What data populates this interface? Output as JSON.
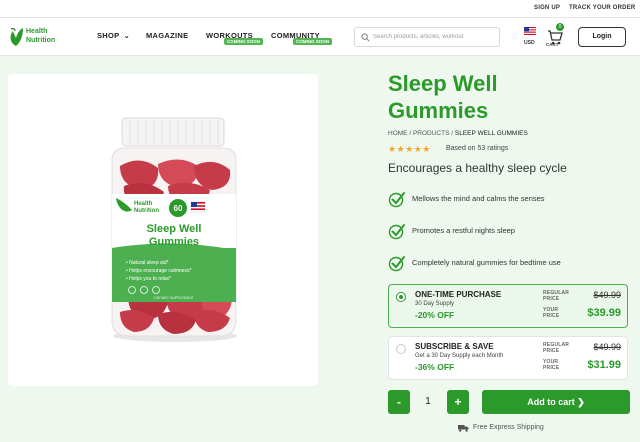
{
  "util": {
    "signup": "SIGN UP",
    "track_order": "TRACK YOUR ORDER"
  },
  "brand": {
    "line1": "Health",
    "line2": "Nutrition",
    "color": "#2b9a2b"
  },
  "nav": {
    "shop": "SHOP",
    "magazine": "MAGAZINE",
    "workouts": "WORKOUTS",
    "community": "COMMUNITY",
    "coming_soon": "COMING SOON"
  },
  "search": {
    "placeholder": "Search products, articles, workout"
  },
  "currency": "USD",
  "cart": {
    "label": "CART",
    "count": "0"
  },
  "login": "Login",
  "product": {
    "title": "Sleep Well Gummies",
    "title_line1": "Sleep Well",
    "title_line2": "Gummies",
    "breadcrumb": [
      "HOME",
      "PRODUCTS",
      "SLEEP WELL GUMMIES"
    ],
    "stars": "★★★★★",
    "rating_text": "Based on 53 ratings",
    "subtitle": "Encourages a healthy sleep cycle",
    "features": [
      "Mellows the mind and calms the senses",
      "Promotes a restful nights sleep",
      "Completely natural gummies for bedtime use"
    ]
  },
  "bottle": {
    "count": "60",
    "brand_line1": "Health",
    "brand_line2": "Nutrition",
    "name_line1": "Sleep Well",
    "name_line2": "Gummies",
    "bullets": [
      "• Natural sleep aid*",
      "• Helps encourage calmness*",
      "• Helps you to relax*"
    ],
    "footer": "DIETARY SUPPLEMENT"
  },
  "options": {
    "one_time": {
      "title": "ONE-TIME PURCHASE",
      "desc": "30 Day Supply",
      "off": "-20% OFF",
      "regular_label": "REGULAR PRICE",
      "your_label": "YOUR PRICE",
      "regular_price": "$49.99",
      "your_price": "$39.99"
    },
    "subscribe": {
      "title": "SUBSCRIBE & SAVE",
      "desc": "Get a 30 Day Supply each Month",
      "off": "-36% OFF",
      "regular_label": "REGULAR PRICE",
      "your_label": "YOUR PRICE",
      "regular_price": "$49.99",
      "your_price": "$31.99"
    }
  },
  "quantity": {
    "minus": "-",
    "value": "1",
    "plus": "+"
  },
  "add_to_cart": "Add to cart ❯",
  "shipping": "Free Express Shipping",
  "colors": {
    "accent": "#2b9a2b",
    "page_bg": "#eef8ee",
    "star": "#f5a623"
  }
}
